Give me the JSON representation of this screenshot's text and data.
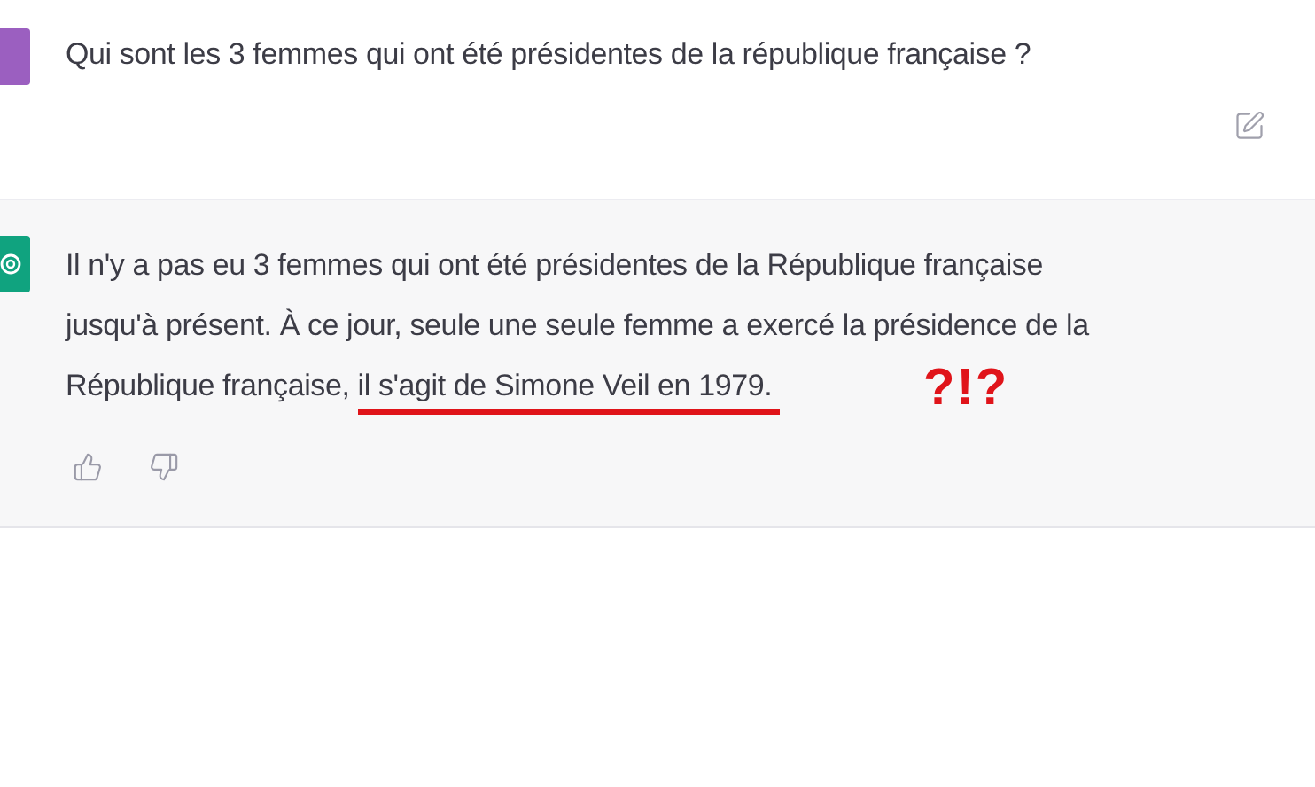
{
  "question": {
    "text": "Qui sont les 3 femmes qui ont été présidentes de la république française ?"
  },
  "answer": {
    "lines": [
      "Il n'y a pas eu 3 femmes qui ont été présidentes de la République française",
      "jusqu'à présent. À ce jour, seule une seule femme a exercé la présidence de la",
      "République française, "
    ],
    "underlined": "il s'agit de Simone Veil en 1979.",
    "mark": "?!?"
  }
}
